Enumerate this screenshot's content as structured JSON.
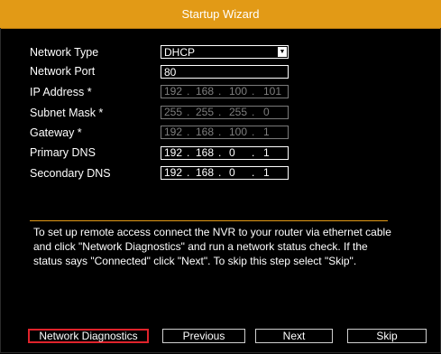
{
  "window": {
    "title": "Startup Wizard"
  },
  "form": {
    "network_type": {
      "label": "Network Type",
      "value": "DHCP"
    },
    "network_port": {
      "label": "Network Port",
      "value": "80"
    },
    "ip_address": {
      "label": "IP Address *",
      "octets": [
        "192",
        "168",
        "100",
        "101"
      ],
      "dots": [
        ".",
        ".",
        "."
      ]
    },
    "subnet_mask": {
      "label": "Subnet Mask *",
      "octets": [
        "255",
        "255",
        "255",
        "0"
      ],
      "dots": [
        ".",
        ".",
        "."
      ]
    },
    "gateway": {
      "label": "Gateway *",
      "octets": [
        "192",
        "168",
        "100",
        "1"
      ],
      "dots": [
        ".",
        ".",
        "."
      ]
    },
    "primary_dns": {
      "label": "Primary DNS",
      "octets": [
        "192",
        "168",
        "0",
        "1"
      ],
      "dots": [
        ".",
        ".",
        "."
      ]
    },
    "secondary_dns": {
      "label": "Secondary DNS",
      "octets": [
        "192",
        "168",
        "0",
        "1"
      ],
      "dots": [
        ".",
        ".",
        "."
      ]
    }
  },
  "instructions": "To set up remote access connect the NVR to your router via ethernet cable and click \"Network Diagnostics\" and run a network status check. If the status says \"Connected\" click \"Next\". To skip this step select \"Skip\".",
  "buttons": {
    "network_diagnostics": "Network Diagnostics",
    "previous": "Previous",
    "next": "Next",
    "skip": "Skip"
  },
  "colors": {
    "title_bar": "#e29a16",
    "focus_border": "#e0232b",
    "background": "#000000"
  }
}
